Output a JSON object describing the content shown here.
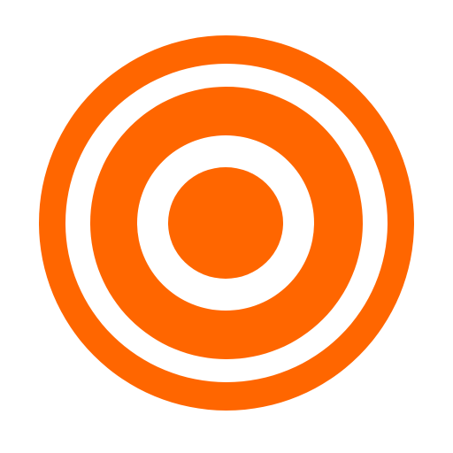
{
  "icon": {
    "name": "target-icon",
    "colors": {
      "primary": "#FF6600",
      "background": "#FFFFFF"
    }
  }
}
